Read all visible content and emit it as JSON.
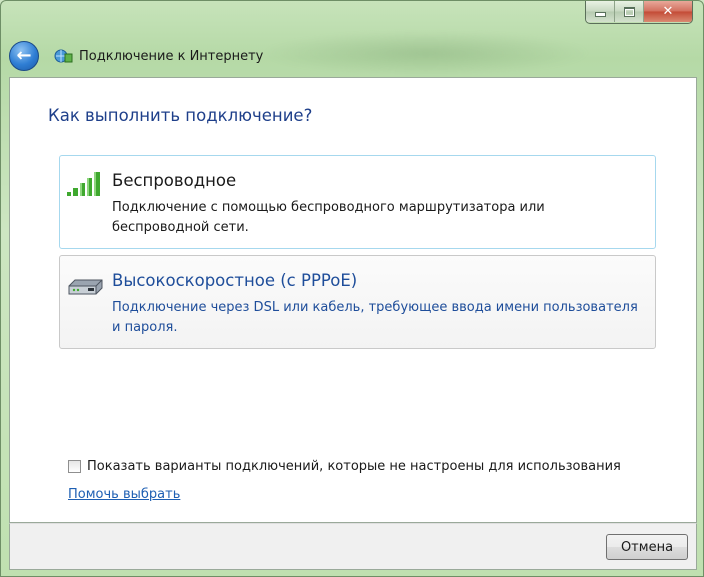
{
  "window": {
    "title": "Подключение к Интернету",
    "minimize_icon": "minimize-icon",
    "maximize_icon": "maximize-icon",
    "close_icon": "close-icon",
    "close_glyph": "✕"
  },
  "nav": {
    "back_icon": "back-arrow-icon",
    "back_glyph": "←",
    "app_icon": "network-connection-icon"
  },
  "main": {
    "heading": "Как выполнить подключение?",
    "options": [
      {
        "title": "Беспроводное",
        "description": "Подключение с помощью беспроводного маршрутизатора или беспроводной сети.",
        "icon": "wireless-signal-icon"
      },
      {
        "title": "Высокоскоростное (с PPPoE)",
        "description": "Подключение через DSL или кабель, требующее ввода имени пользователя и пароля.",
        "icon": "modem-icon"
      }
    ],
    "show_unconfigured": {
      "label": "Показать варианты подключений, которые не настроены для использования",
      "checked": false
    },
    "help_link": "Помочь выбрать"
  },
  "footer": {
    "cancel_label": "Отмена"
  },
  "colors": {
    "heading": "#1e3f8a",
    "link": "#1e5fb3",
    "wireless_border": "#a6d8ee",
    "signal_green": "#3fa82f"
  }
}
